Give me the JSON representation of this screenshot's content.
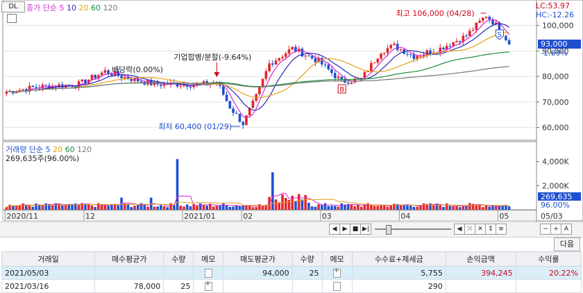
{
  "chart_header": {
    "dl_label": "DL",
    "price_line_label": "종가 단순",
    "ma_periods": [
      "5",
      "10",
      "20",
      "60",
      "120"
    ],
    "lc_label": "LC:53.97",
    "hc_label": "HC:-12.26"
  },
  "colors": {
    "up": "#e5242a",
    "down": "#1f4fd1",
    "ma5": "#d22bd2",
    "ma10": "#2a2ab7",
    "ma20": "#e3a117",
    "ma60": "#1a8f3a",
    "ma120": "#777777",
    "price_badge": "#1f4fd1",
    "volume_badge": "#1f4fd1"
  },
  "annotations": {
    "high": "최고 106,000 (04/28)",
    "low": "최저 60,400 (01/29)",
    "split": "기업합병/분할(-9.64%)",
    "ex_rights": "배당락(0.00%)",
    "buy_marker": "B",
    "sell_marker": "S"
  },
  "price_axis": {
    "ticks": [
      "100,000",
      "90,000",
      "80,000",
      "70,000",
      "60,000"
    ],
    "current_price": "93,000",
    "change_rate": "-1.69%"
  },
  "volume_panel": {
    "title": "거래량 단순",
    "ma_periods": [
      "5",
      "20",
      "60",
      "120"
    ],
    "current_volume_label": "269,635주(96.00%)",
    "axis_ticks": [
      "4,000K",
      "2,000K"
    ],
    "current_volume": "269,635",
    "current_ratio": "96.00%"
  },
  "date_axis": {
    "labels": [
      "2020/11",
      "12",
      "2021/01",
      "02",
      "03",
      "04",
      "05"
    ],
    "right_date": "05/03"
  },
  "chart_data": {
    "type": "bar",
    "title": "",
    "y_range": [
      55000,
      110000
    ],
    "ohlc_approx": {
      "low": 60400,
      "low_date": "01/29",
      "high": 106000,
      "high_date": "04/28",
      "last": 93000
    },
    "volume_ylim": [
      0,
      4500000
    ],
    "moving_averages": [
      "5",
      "10",
      "20",
      "60",
      "120"
    ]
  },
  "next_button": "다음",
  "table": {
    "headers": [
      "거래일",
      "매수평균가",
      "수량",
      "메모",
      "매도평균가",
      "수량",
      "메모",
      "수수료+제세금",
      "손익금액",
      "수익률"
    ],
    "rows": [
      {
        "date": "2021/05/03",
        "buy_avg": "",
        "buy_qty": "",
        "buy_memo": "blank",
        "sell_avg": "94,000",
        "sell_qty": "25",
        "sell_memo": "plus",
        "fee": "5,755",
        "profit": "394,245",
        "rate": "20.22%"
      },
      {
        "date": "2021/03/16",
        "buy_avg": "78,000",
        "buy_qty": "25",
        "buy_memo": "plus",
        "sell_avg": "",
        "sell_qty": "",
        "sell_memo": "blank",
        "fee": "290",
        "profit": "",
        "rate": ""
      }
    ]
  }
}
